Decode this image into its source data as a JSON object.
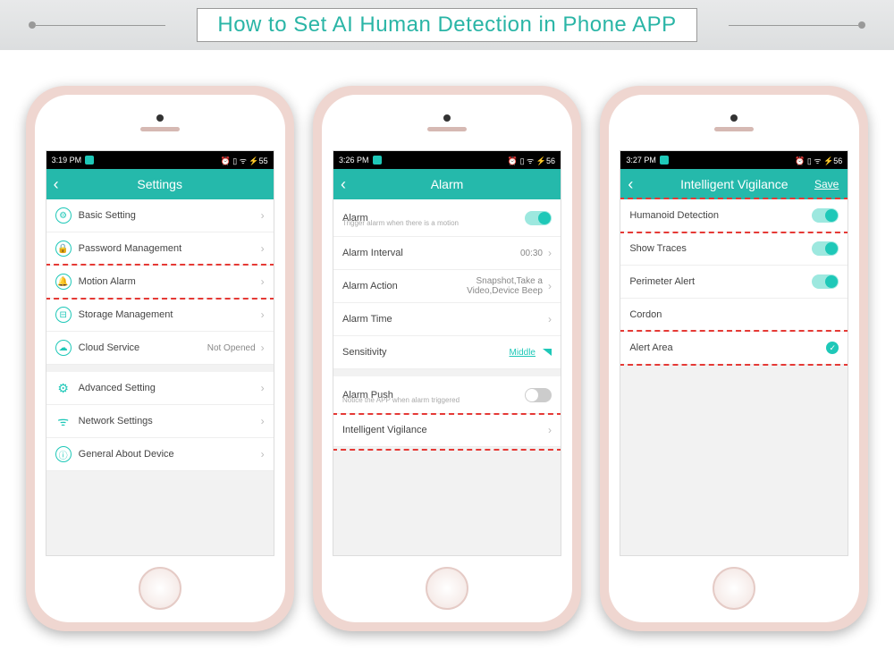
{
  "banner": {
    "title": "How to Set AI Human Detection in Phone APP"
  },
  "phone1": {
    "time": "3:19 PM",
    "statusIcons": "⏰ ▯ ᯤ ⚡55",
    "header": "Settings",
    "rows": [
      {
        "icon": "⚙",
        "label": "Basic Setting"
      },
      {
        "icon": "🔒",
        "label": "Password Management"
      },
      {
        "icon": "🔔",
        "label": "Motion Alarm"
      },
      {
        "icon": "⊟",
        "label": "Storage Management"
      },
      {
        "icon": "☁",
        "label": "Cloud Service",
        "val": "Not Opened"
      },
      {
        "icon": "⚙",
        "label": "Advanced Setting",
        "nb": true,
        "iconText": "⫶⫶"
      },
      {
        "icon": "ᯤ",
        "label": "Network Settings",
        "nb": true
      },
      {
        "icon": "ⓘ",
        "label": "General About Device"
      }
    ]
  },
  "phone2": {
    "time": "3:26 PM",
    "statusIcons": "⏰ ▯ ᯤ ⚡56",
    "header": "Alarm",
    "rows": [
      {
        "label": "Alarm",
        "sub": "Trigger alarm when there is a motion",
        "toggle": "on"
      },
      {
        "label": "Alarm Interval",
        "val": "00:30"
      },
      {
        "label": "Alarm Action",
        "val": "Snapshot,Take a Video,Device Beep"
      },
      {
        "label": "Alarm Time"
      },
      {
        "label": "Sensitivity",
        "val": "Middle",
        "sig": true
      },
      {
        "label": "Alarm Push",
        "sub": "Notice the APP when alarm triggered",
        "toggle": "off",
        "gap": true
      },
      {
        "label": "Intelligent Vigilance"
      }
    ]
  },
  "phone3": {
    "time": "3:27 PM",
    "statusIcons": "⏰ ▯ ᯤ ⚡56",
    "header": "Intelligent Vigilance",
    "save": "Save",
    "rows": [
      {
        "label": "Humanoid Detection",
        "toggle": "on"
      },
      {
        "label": "Show Traces",
        "toggle": "on"
      },
      {
        "label": "Perimeter Alert",
        "toggle": "on"
      },
      {
        "label": "Cordon"
      },
      {
        "label": "Alert Area",
        "check": true
      }
    ]
  }
}
